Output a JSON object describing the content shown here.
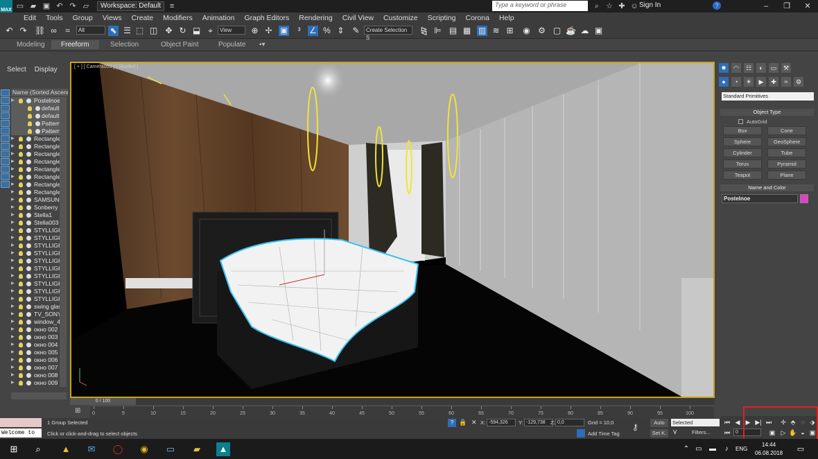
{
  "app": {
    "logo_text": "MAX",
    "workspace": "Workspace: Default",
    "search_placeholder": "Type a keyword or phrase",
    "sign_in": "Sign In"
  },
  "menu": [
    "Edit",
    "Tools",
    "Group",
    "Views",
    "Create",
    "Modifiers",
    "Animation",
    "Graph Editors",
    "Rendering",
    "Civil View",
    "Customize",
    "Scripting",
    "Corona",
    "Help"
  ],
  "toolbar": {
    "selection_filter": "All",
    "ref_coord": "View",
    "selection_set": "Create Selection S"
  },
  "ribbon_tabs": [
    "Modeling",
    "Freeform",
    "Selection",
    "Object Paint",
    "Populate"
  ],
  "explorer": {
    "tabs": [
      "Select",
      "Display"
    ],
    "header": "Name (Sorted Ascending)",
    "rows": [
      {
        "label": "Postelnoe",
        "child": false,
        "selected": true
      },
      {
        "label": "default",
        "child": true,
        "selected": true
      },
      {
        "label": "default",
        "child": true,
        "selected": true
      },
      {
        "label": "Pattern",
        "child": true,
        "selected": true
      },
      {
        "label": "Pattern",
        "child": true,
        "selected": true
      },
      {
        "label": "Rectangle",
        "child": false,
        "selected": false
      },
      {
        "label": "Rectangle",
        "child": false,
        "selected": false
      },
      {
        "label": "Rectangle",
        "child": false,
        "selected": false
      },
      {
        "label": "Rectangle",
        "child": false,
        "selected": false
      },
      {
        "label": "Rectangle",
        "child": false,
        "selected": false
      },
      {
        "label": "Rectangle",
        "child": false,
        "selected": false
      },
      {
        "label": "Rectangle",
        "child": false,
        "selected": false
      },
      {
        "label": "Rectangle",
        "child": false,
        "selected": false
      },
      {
        "label": "SAMSUNG",
        "child": false,
        "selected": false
      },
      {
        "label": "Sonberry",
        "child": false,
        "selected": false
      },
      {
        "label": "Stella1",
        "child": false,
        "selected": false
      },
      {
        "label": "Stella003",
        "child": false,
        "selected": false
      },
      {
        "label": "STYLLIGH",
        "child": false,
        "selected": false
      },
      {
        "label": "STYLLIGH",
        "child": false,
        "selected": false
      },
      {
        "label": "STYLLIGH",
        "child": false,
        "selected": false
      },
      {
        "label": "STYLLIGH",
        "child": false,
        "selected": false
      },
      {
        "label": "STYLLIGH",
        "child": false,
        "selected": false
      },
      {
        "label": "STYLLIGH",
        "child": false,
        "selected": false
      },
      {
        "label": "STYLLIGH",
        "child": false,
        "selected": false
      },
      {
        "label": "STYLLIGH",
        "child": false,
        "selected": false
      },
      {
        "label": "STYLLIGH",
        "child": false,
        "selected": false
      },
      {
        "label": "STYLLIGH",
        "child": false,
        "selected": false
      },
      {
        "label": "swing glas",
        "child": false,
        "selected": false
      },
      {
        "label": "TV_SONY",
        "child": false,
        "selected": false
      },
      {
        "label": "window_4",
        "child": false,
        "selected": false
      },
      {
        "label": "окно 002",
        "child": false,
        "selected": false
      },
      {
        "label": "окно 003",
        "child": false,
        "selected": false
      },
      {
        "label": "окно 004",
        "child": false,
        "selected": false
      },
      {
        "label": "окно 005",
        "child": false,
        "selected": false
      },
      {
        "label": "окно 006",
        "child": false,
        "selected": false
      },
      {
        "label": "окно 007",
        "child": false,
        "selected": false
      },
      {
        "label": "окно 008",
        "child": false,
        "selected": false
      },
      {
        "label": "окно 009",
        "child": false,
        "selected": false
      }
    ]
  },
  "viewport": {
    "label": "[ + ] [ Camera003 ] [ Shaded ]"
  },
  "command_panel": {
    "category": "Standard Primitives",
    "object_type_title": "Object Type",
    "autogrid": "AutoGrid",
    "primitives": [
      "Box",
      "Cone",
      "Sphere",
      "GeoSphere",
      "Cylinder",
      "Tube",
      "Torus",
      "Pyramid",
      "Teapot",
      "Plane"
    ],
    "name_color_title": "Name and Color",
    "object_name": "Postelnoe",
    "object_color": "#e23fc8"
  },
  "timeline": {
    "slider_label": "0 / 100",
    "ticks": [
      "0",
      "5",
      "10",
      "15",
      "20",
      "25",
      "30",
      "35",
      "40",
      "45",
      "50",
      "55",
      "60",
      "65",
      "70",
      "75",
      "80",
      "85",
      "90",
      "95",
      "100"
    ]
  },
  "status": {
    "listener": "Welcome to",
    "selection": "1 Group Selected",
    "prompt": "Click or click-and-drag to select objects",
    "x_label": "X:",
    "x_value": "-594,326",
    "y_label": "Y:",
    "y_value": "-129,738",
    "z_label": "Z:",
    "z_value": "0,0",
    "grid": "Grid = 10,0",
    "time_tag": "Add Time Tag",
    "auto": "Auto",
    "set_key": "Set K.",
    "selected": "Selected",
    "filters": "Filters...",
    "frame": "0"
  },
  "taskbar": {
    "lang": "ENG",
    "time": "14:44",
    "date": "06.08.2018"
  }
}
